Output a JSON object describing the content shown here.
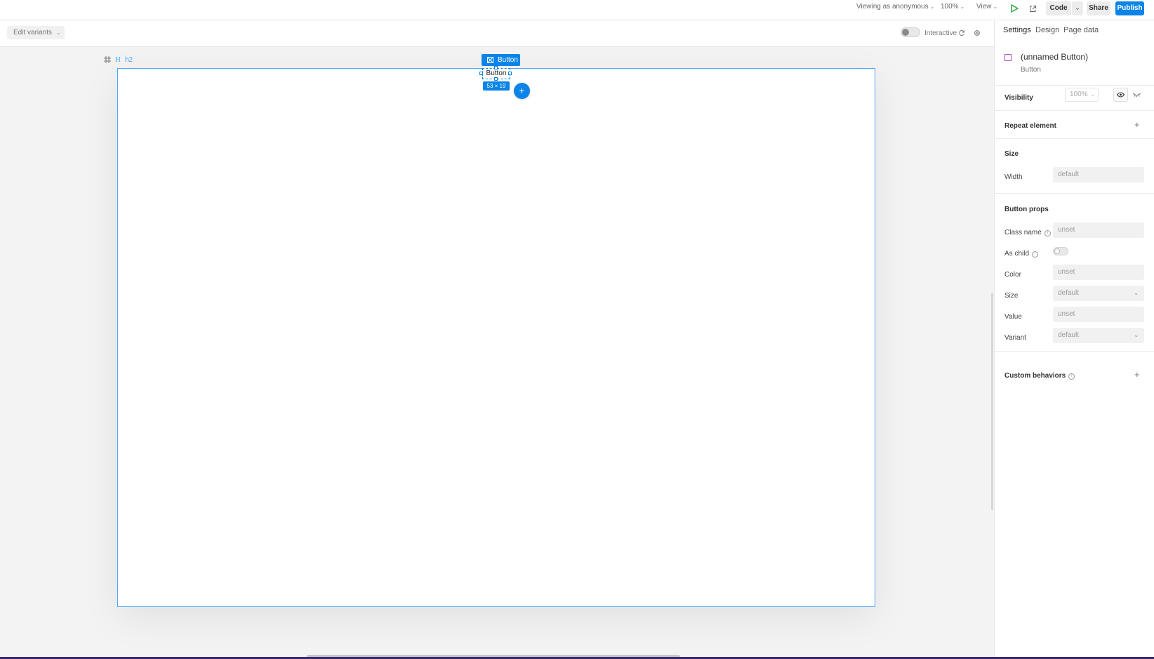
{
  "topbar": {
    "viewing_as": "Viewing as anonymous",
    "zoom": "100%",
    "view": "View",
    "code": "Code",
    "share": "Share",
    "publish": "Publish"
  },
  "subbar": {
    "edit_variants": "Edit variants",
    "interactive": "Interactive"
  },
  "canvas": {
    "frame_icon_letter": "H",
    "frame_name": "h2",
    "selection_tag": "Button",
    "selected_text": "Button",
    "size_readout": "53 × 19",
    "add_symbol": "+"
  },
  "panel": {
    "tabs": [
      {
        "label": "Settings"
      },
      {
        "label": "Design"
      },
      {
        "label": "Page data"
      }
    ],
    "element": {
      "name": "(unnamed Button)",
      "type": "Button"
    },
    "visibility": {
      "label": "Visibility",
      "value": "100%"
    },
    "repeat_element": "Repeat element",
    "size_section": {
      "title": "Size",
      "width_label": "Width",
      "width_value": "default"
    },
    "button_props": {
      "title": "Button props",
      "class_name_label": "Class name",
      "class_name_value": "unset",
      "as_child_label": "As child",
      "color_label": "Color",
      "color_value": "unset",
      "size_label": "Size",
      "size_value": "default",
      "value_label": "Value",
      "value_value": "unset",
      "variant_label": "Variant",
      "variant_value": "default"
    },
    "custom_behaviors": "Custom behaviors"
  },
  "colors": {
    "accent": "#0a84e8",
    "play_green": "#2aa845",
    "element_icon": "#b44dcf"
  }
}
